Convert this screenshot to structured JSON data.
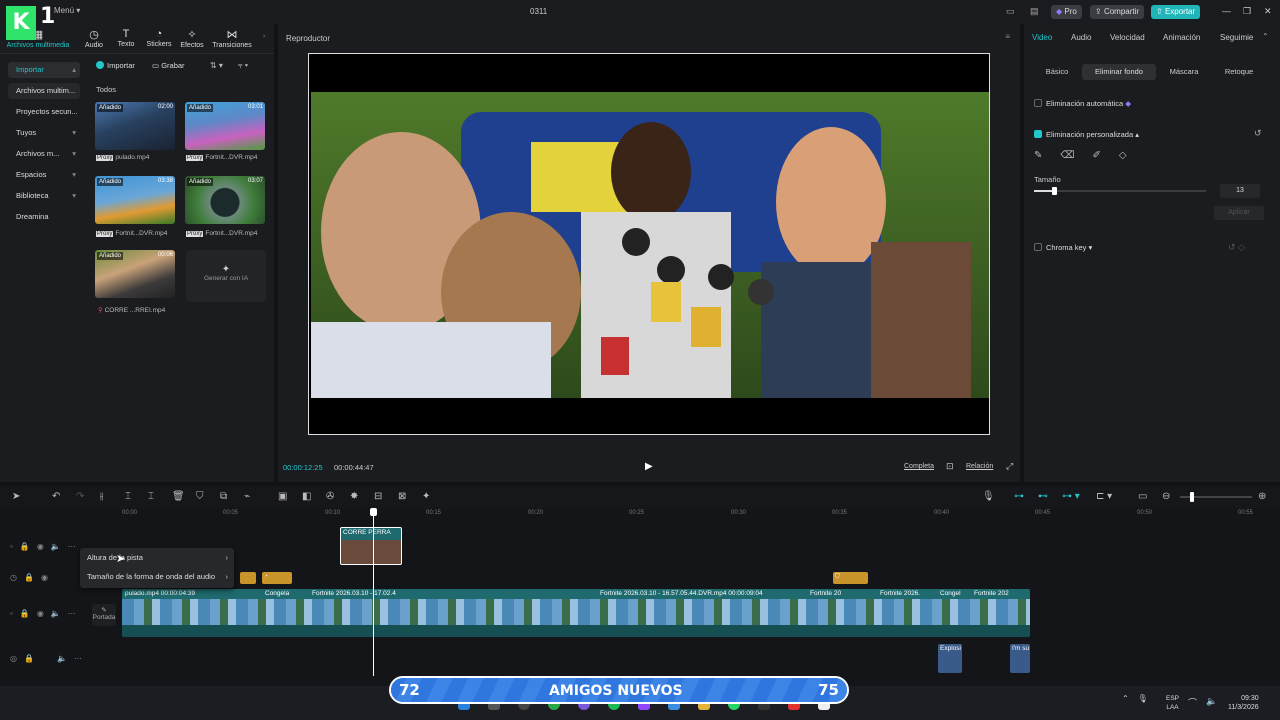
{
  "app": {
    "logo": "K",
    "logo_number": "1",
    "menu": "Menú",
    "project_title": "0311",
    "pro": "Pro",
    "share": "Compartir",
    "export": "Exportar"
  },
  "media_tabs": [
    {
      "label": "Archivos multimedia",
      "icon": "media-icon"
    },
    {
      "label": "Audio",
      "icon": "audio-icon"
    },
    {
      "label": "Texto",
      "icon": "text-icon"
    },
    {
      "label": "Stickers",
      "icon": "sticker-icon"
    },
    {
      "label": "Efectos",
      "icon": "effects-icon"
    },
    {
      "label": "Transiciones",
      "icon": "transitions-icon"
    }
  ],
  "left_nav": [
    "Importar",
    "Archivos multim...",
    "Proyectos secun...",
    "Tuyos",
    "Archivos m...",
    "Espacios",
    "Biblioteca",
    "Dreamina"
  ],
  "media": {
    "import": "Importar",
    "record": "Grabar",
    "all": "Todos",
    "added": "Añadido",
    "proxy": "Proxy",
    "items": [
      {
        "name": "pulado.mp4",
        "duration": "02:00"
      },
      {
        "name": "Fortnit...DVR.mp4",
        "duration": "03:01"
      },
      {
        "name": "Fortnit...DVR.mp4",
        "duration": "03:38"
      },
      {
        "name": "Fortnit...DVR.mp4",
        "duration": "03:07"
      },
      {
        "name": "CORRE ...RREI.mp4",
        "duration": "00:06"
      }
    ],
    "generate_ai": "Generar con IA"
  },
  "player": {
    "title": "Reproductor",
    "current_time": "00:00:12:25",
    "total_time": "00:00:44:47",
    "full": "Completa",
    "ratio": "Relación"
  },
  "inspector": {
    "tabs": [
      "Video",
      "Audio",
      "Velocidad",
      "Animación",
      "Seguimie"
    ],
    "subtabs": [
      "Básico",
      "Eliminar fondo",
      "Máscara",
      "Retoque"
    ],
    "auto_remove": "Eliminación automática",
    "custom_remove": "Eliminación personalizada",
    "size_label": "Tamaño",
    "size_value": "13",
    "apply": "Aplicar",
    "chroma_key": "Chroma key"
  },
  "timeline": {
    "ruler": [
      "00:00",
      "00:05",
      "00:10",
      "00:15",
      "00:20",
      "00:25",
      "00:30",
      "00:35",
      "00:40",
      "00:45",
      "00:50",
      "00:55"
    ],
    "cover": "Portada",
    "clip_top": "CORRE PERRA",
    "main_clips": [
      {
        "label": "pulado.mp4  00:00:04:39"
      },
      {
        "label": "Congela"
      },
      {
        "label": "Fortnite 2026.03.10 - 17.02.4"
      },
      {
        "label": "Fortnite 2026.03.10 - 16.57.05.44.DVR.mp4  00:00:09:04"
      },
      {
        "label": "Fortnite 20"
      },
      {
        "label": "Fortnite 2026."
      },
      {
        "label": "Congel"
      },
      {
        "label": "Fortnite 202"
      }
    ],
    "audio_clips": [
      "Explosi",
      "I'm su"
    ],
    "ctx_menu": [
      "Altura de la pista",
      "Tamaño de la forma de onda del audio"
    ]
  },
  "banner": {
    "left": "72",
    "center": "AMIGOS NUEVOS",
    "right": "75"
  },
  "taskbar": {
    "lang": "ESP",
    "lang2": "LAA",
    "time": "09:30",
    "date": "11/3/2026"
  },
  "colors": {
    "accent": "#21c7c9",
    "panel": "#1b1c1f",
    "banner": "#2c6fd1"
  }
}
